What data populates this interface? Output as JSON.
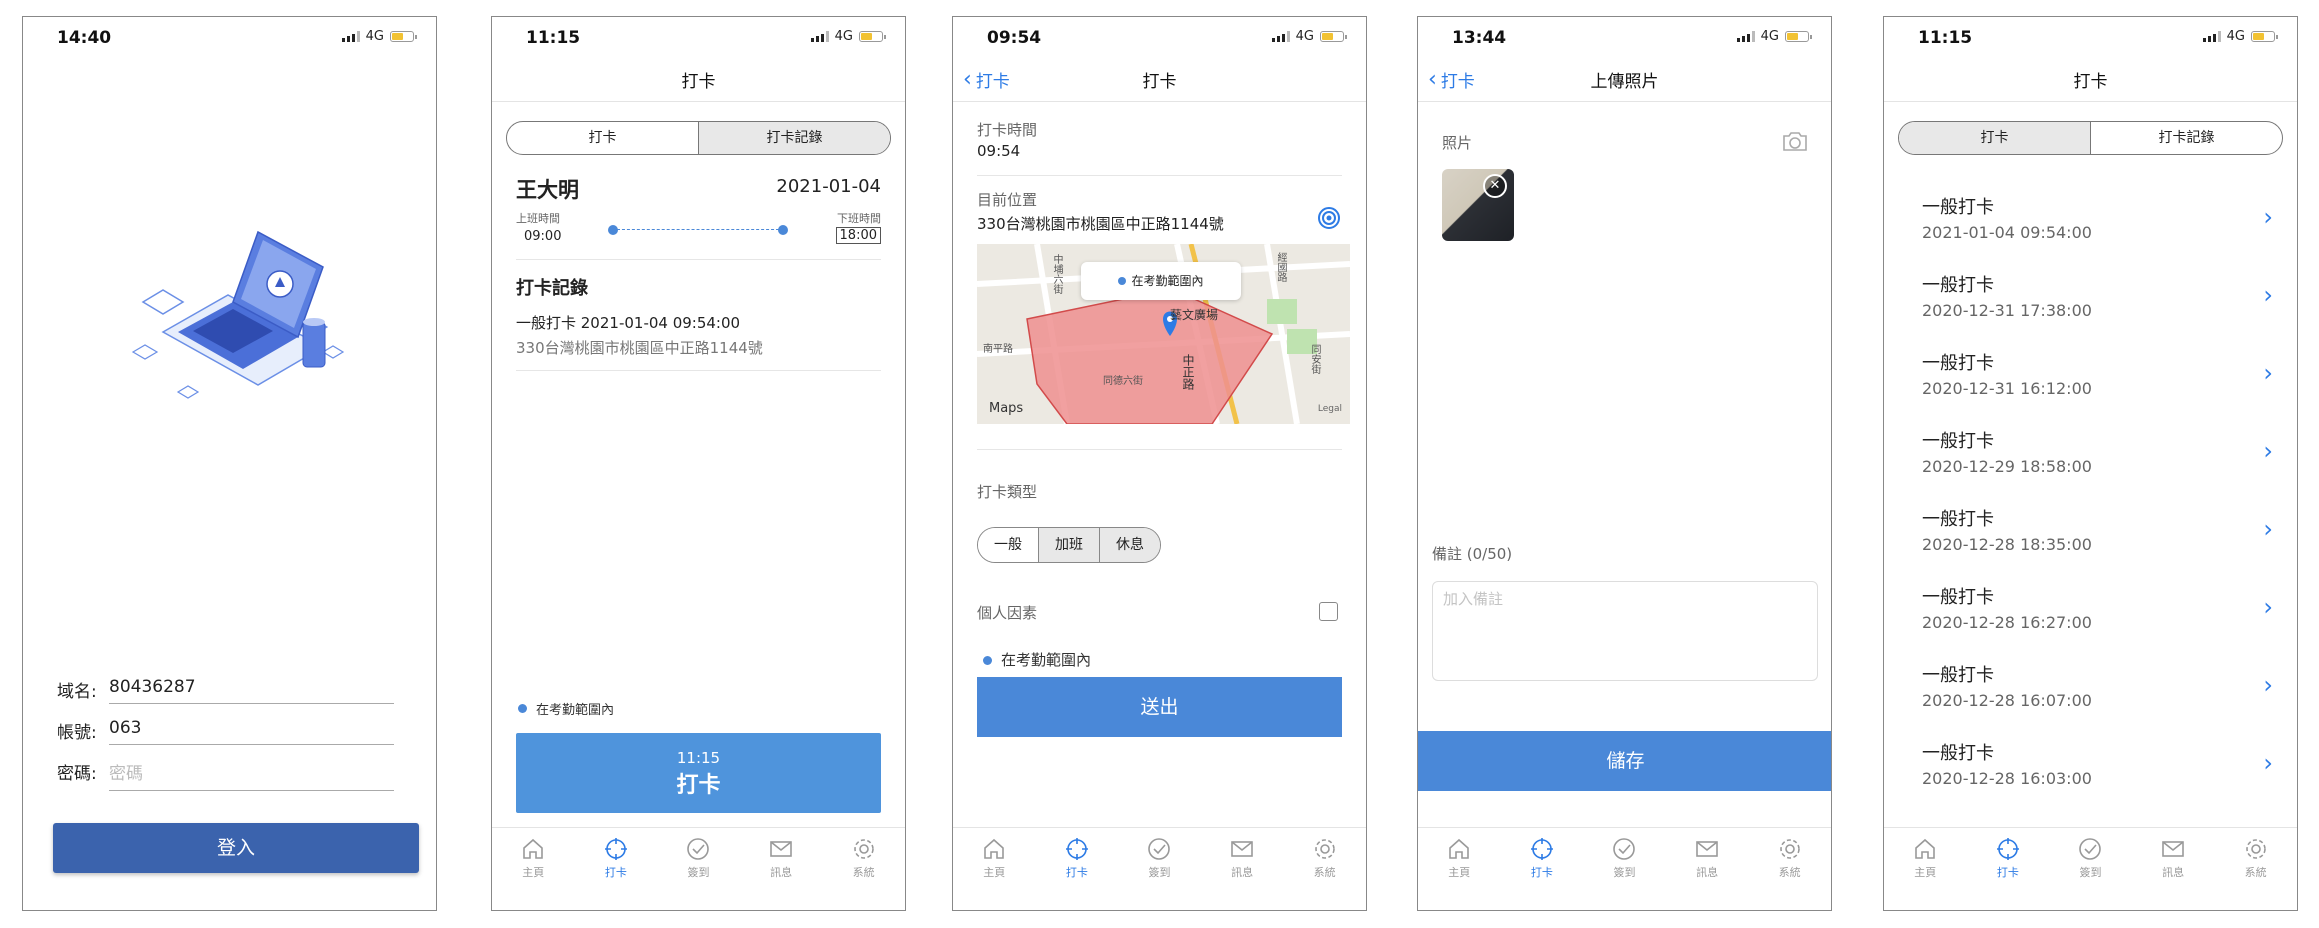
{
  "screens": {
    "login": {
      "time": "14:40",
      "network": "4G",
      "domain_label": "域名:",
      "domain_value": "80436287",
      "account_label": "帳號:",
      "account_value": "063",
      "password_label": "密碼:",
      "password_placeholder": "密碼",
      "login_button": "登入"
    },
    "punch": {
      "time": "11:15",
      "network": "4G",
      "title": "打卡",
      "tabs": [
        "打卡",
        "打卡記錄"
      ],
      "name": "王大明",
      "date": "2021-01-04",
      "work_start_label": "上班時間",
      "work_start": "09:00",
      "work_end_label": "下班時間",
      "work_end": "18:00",
      "records_title": "打卡記錄",
      "record_line": "一般打卡 2021-01-04 09:54:00",
      "record_address": "330台灣桃園市桃園區中正路1144號",
      "range_status": "在考勤範圍內",
      "button_time": "11:15",
      "button_label": "打卡"
    },
    "detail": {
      "time": "09:54",
      "network": "4G",
      "back_label": "打卡",
      "title": "打卡",
      "punch_time_label": "打卡時間",
      "punch_time_value": "09:54",
      "location_label": "目前位置",
      "location_value": "330台灣桃園市桃園區中正路1144號",
      "map_popup": "在考勤範圍內",
      "map_brand": "Maps",
      "map_legal": "Legal",
      "map_streets": [
        "中正路",
        "同德六街",
        "南平路",
        "中埔六街",
        "同安街",
        "藝文廣場",
        "經國路"
      ],
      "type_label": "打卡類型",
      "type_options": [
        "一般",
        "加班",
        "休息"
      ],
      "personal_label": "個人因素",
      "range_status": "在考勤範圍內",
      "submit_button": "送出"
    },
    "upload": {
      "time": "13:44",
      "network": "4G",
      "back_label": "打卡",
      "title": "上傳照片",
      "photo_label": "照片",
      "note_label": "備註 (0/50)",
      "note_placeholder": "加入備註",
      "save_button": "儲存"
    },
    "records": {
      "time": "11:15",
      "network": "4G",
      "title": "打卡",
      "tabs": [
        "打卡",
        "打卡記錄"
      ],
      "items": [
        {
          "type": "一般打卡",
          "datetime": "2021-01-04 09:54:00"
        },
        {
          "type": "一般打卡",
          "datetime": "2020-12-31 17:38:00"
        },
        {
          "type": "一般打卡",
          "datetime": "2020-12-31 16:12:00"
        },
        {
          "type": "一般打卡",
          "datetime": "2020-12-29 18:58:00"
        },
        {
          "type": "一般打卡",
          "datetime": "2020-12-28 18:35:00"
        },
        {
          "type": "一般打卡",
          "datetime": "2020-12-28 16:27:00"
        },
        {
          "type": "一般打卡",
          "datetime": "2020-12-28 16:07:00"
        },
        {
          "type": "一般打卡",
          "datetime": "2020-12-28 16:03:00"
        }
      ]
    }
  },
  "tabbar": {
    "items": [
      {
        "label": "主頁",
        "icon": "home-icon"
      },
      {
        "label": "打卡",
        "icon": "crosshair-icon"
      },
      {
        "label": "簽到",
        "icon": "check-circle-icon"
      },
      {
        "label": "訊息",
        "icon": "mail-icon"
      },
      {
        "label": "系統",
        "icon": "gear-icon"
      }
    ],
    "active_index": 1
  },
  "colors": {
    "primary_blue": "#4a88d8",
    "login_blue": "#3b63ad",
    "accent": "#2d7be5",
    "map_zone": "#ef8f8f"
  }
}
